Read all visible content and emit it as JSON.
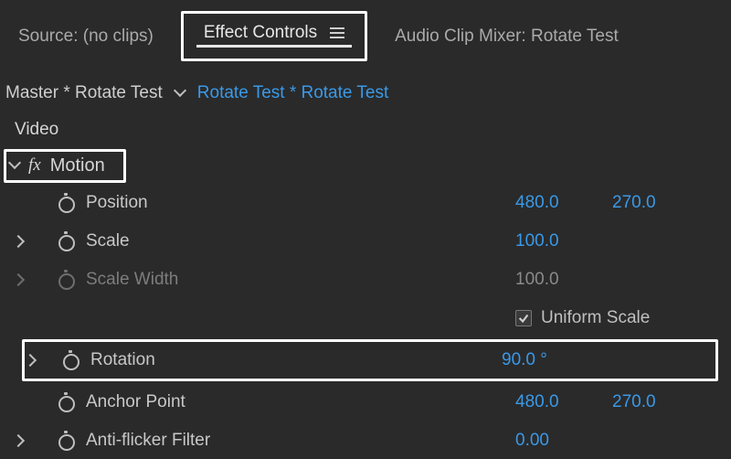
{
  "tabs": {
    "source": "Source: (no clips)",
    "effect_controls": "Effect Controls",
    "audio_mixer": "Audio Clip Mixer: Rotate Test"
  },
  "breadcrumb": {
    "master": "Master * Rotate Test",
    "clip": "Rotate Test * Rotate Test"
  },
  "sections": {
    "video": "Video",
    "motion": "Motion"
  },
  "fx_label": "fx",
  "props": {
    "position": {
      "label": "Position",
      "x": "480.0",
      "y": "270.0"
    },
    "scale": {
      "label": "Scale",
      "value": "100.0"
    },
    "scale_width": {
      "label": "Scale Width",
      "value": "100.0"
    },
    "uniform_scale": {
      "label": "Uniform Scale",
      "checked": true
    },
    "rotation": {
      "label": "Rotation",
      "value": "90.0 °"
    },
    "anchor": {
      "label": "Anchor Point",
      "x": "480.0",
      "y": "270.0"
    },
    "antiflicker": {
      "label": "Anti-flicker Filter",
      "value": "0.00"
    }
  }
}
